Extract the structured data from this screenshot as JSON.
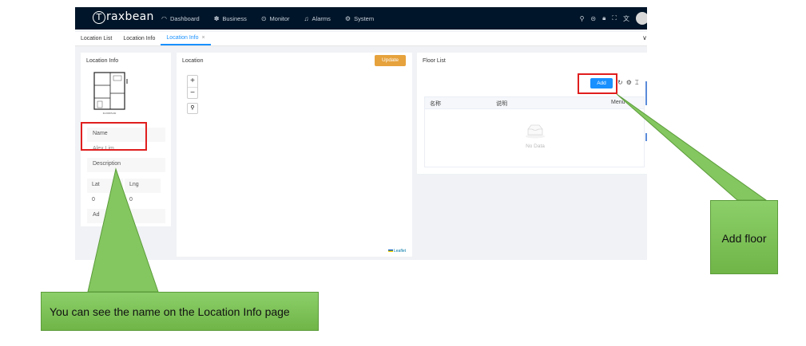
{
  "app": {
    "brand": "raxbean",
    "brand_initial": "T",
    "nav": [
      {
        "label": "Dashboard",
        "icon": "dashboard-icon"
      },
      {
        "label": "Business",
        "icon": "business-icon"
      },
      {
        "label": "Monitor",
        "icon": "monitor-icon"
      },
      {
        "label": "Alarms",
        "icon": "alarm-icon"
      },
      {
        "label": "System",
        "icon": "system-icon"
      }
    ],
    "tabs": [
      {
        "label": "Location List",
        "active": false
      },
      {
        "label": "Location Info",
        "active": false
      },
      {
        "label": "Location Info",
        "active": true,
        "close": "×"
      }
    ],
    "collapse_glyph": "∨"
  },
  "info_card": {
    "title": "Location Info",
    "floorplan_caption": "FLOOR PLAN",
    "name_label": "Name",
    "name_value": "Alex Lim",
    "description_label": "Description",
    "lat_label": "Lat",
    "lng_label": "Lng",
    "lat_value": "0",
    "lng_value": "0",
    "address_label": "Ad"
  },
  "map_card": {
    "title": "Location",
    "update_label": "Update",
    "zoom_in": "+",
    "zoom_out": "−",
    "attribution": "Leaflet"
  },
  "floor_card": {
    "title": "Floor List",
    "add_label": "Add",
    "columns": [
      "名称",
      "说明",
      "Menu"
    ],
    "empty_text": "No Data"
  },
  "annotations": {
    "left_callout": "You can see the name on the Location Info page",
    "right_callout": "Add floor"
  },
  "colors": {
    "topbar": "#001529",
    "primary": "#1890ff",
    "update": "#e6a23c",
    "highlight": "#e01e1e",
    "callout": "#7ec25a"
  }
}
